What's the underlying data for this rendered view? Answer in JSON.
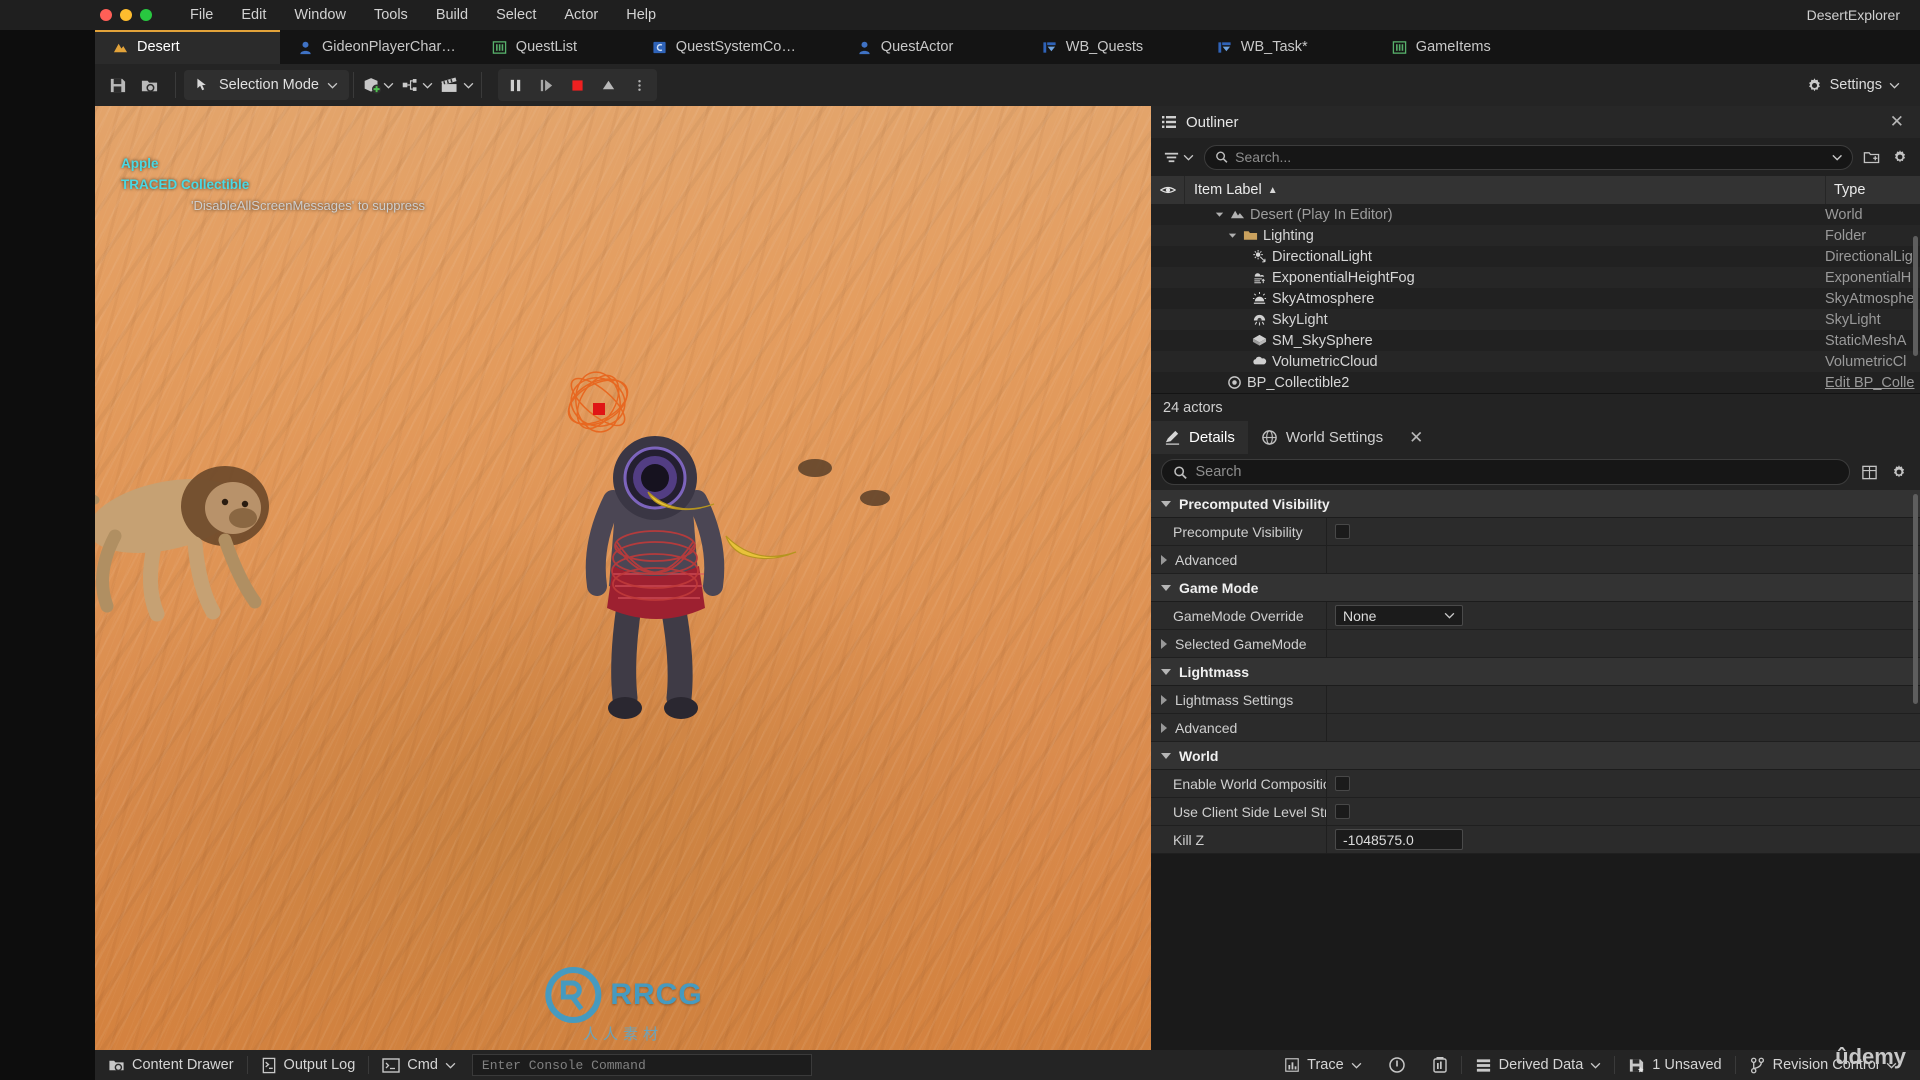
{
  "window": {
    "title": "DesertExplorer"
  },
  "menu": {
    "items": [
      "File",
      "Edit",
      "Window",
      "Tools",
      "Build",
      "Select",
      "Actor",
      "Help"
    ]
  },
  "tabs": [
    {
      "label": "Desert",
      "icon": "level-icon",
      "active": true
    },
    {
      "label": "GideonPlayerChar…",
      "icon": "blueprint-character-icon",
      "active": false
    },
    {
      "label": "QuestList",
      "icon": "datatable-icon",
      "active": false
    },
    {
      "label": "QuestSystemCo…",
      "icon": "blueprint-component-icon",
      "active": false
    },
    {
      "label": "QuestActor",
      "icon": "blueprint-actor-icon",
      "active": false
    },
    {
      "label": "WB_Quests",
      "icon": "widget-blueprint-icon",
      "active": false
    },
    {
      "label": "WB_Task*",
      "icon": "widget-blueprint-icon",
      "active": false
    },
    {
      "label": "GameItems",
      "icon": "datatable-icon",
      "active": false
    }
  ],
  "toolbar": {
    "save_label": "Save",
    "browse_label": "Browse",
    "mode_label": "Selection Mode",
    "add_label": "Add",
    "blueprints_label": "Blueprints",
    "cinematics_label": "Cinematics",
    "pause_label": "Pause",
    "frame_label": "Skip Frame",
    "stop_label": "Stop",
    "eject_label": "Eject",
    "options_label": "More Options",
    "settings_label": "Settings"
  },
  "viewport": {
    "debug_lines": [
      "Apple",
      "TRACED Collectible",
      "'DisableAllScreenMessages' to suppress"
    ],
    "watermark": {
      "text": "RRCG",
      "sub": "人人素材"
    },
    "brand": "ûdemy"
  },
  "outliner": {
    "title": "Outliner",
    "search_placeholder": "Search...",
    "columns": {
      "label": "Item Label",
      "type": "Type"
    },
    "sort_indicator": "▲",
    "rows": [
      {
        "label": "Desert (Play In Editor)",
        "type": "World",
        "indent": 1,
        "arrow": "down",
        "icon": "world-icon",
        "dim": true
      },
      {
        "label": "Lighting",
        "type": "Folder",
        "indent": 2,
        "arrow": "down",
        "icon": "folder-icon",
        "dim": false
      },
      {
        "label": "DirectionalLight",
        "type": "DirectionalLig",
        "indent": 3,
        "arrow": "none",
        "icon": "directional-light-icon",
        "dim": false
      },
      {
        "label": "ExponentialHeightFog",
        "type": "ExponentialH",
        "indent": 3,
        "arrow": "none",
        "icon": "fog-icon",
        "dim": false
      },
      {
        "label": "SkyAtmosphere",
        "type": "SkyAtmosphe",
        "indent": 3,
        "arrow": "none",
        "icon": "sky-atmosphere-icon",
        "dim": false
      },
      {
        "label": "SkyLight",
        "type": "SkyLight",
        "indent": 3,
        "arrow": "none",
        "icon": "sky-light-icon",
        "dim": false
      },
      {
        "label": "SM_SkySphere",
        "type": "StaticMeshA",
        "indent": 3,
        "arrow": "none",
        "icon": "static-mesh-icon",
        "dim": false
      },
      {
        "label": "VolumetricCloud",
        "type": "VolumetricCl",
        "indent": 3,
        "arrow": "none",
        "icon": "cloud-icon",
        "dim": false
      },
      {
        "label": "BP_Collectible2",
        "type": "Edit BP_Colle",
        "indent": 2,
        "arrow": "none",
        "icon": "blueprint-actor-icon",
        "dim": false,
        "type_is_link": true
      }
    ],
    "actor_count": "24 actors"
  },
  "details": {
    "tabs": [
      {
        "label": "Details",
        "icon": "details-icon",
        "active": true
      },
      {
        "label": "World Settings",
        "icon": "world-settings-icon",
        "active": false
      }
    ],
    "search_placeholder": "Search",
    "sections": [
      {
        "name": "Precomputed Visibility",
        "expanded": true,
        "rows": [
          {
            "label": "Precompute Visibility",
            "control": "checkbox",
            "value": "",
            "expandable": false
          },
          {
            "label": "Advanced",
            "control": "none",
            "value": "",
            "expandable": true
          }
        ]
      },
      {
        "name": "Game Mode",
        "expanded": true,
        "rows": [
          {
            "label": "GameMode Override",
            "control": "dropdown",
            "value": "None",
            "expandable": false
          },
          {
            "label": "Selected GameMode",
            "control": "none",
            "value": "",
            "expandable": true
          }
        ]
      },
      {
        "name": "Lightmass",
        "expanded": true,
        "rows": [
          {
            "label": "Lightmass Settings",
            "control": "none",
            "value": "",
            "expandable": true
          },
          {
            "label": "Advanced",
            "control": "none",
            "value": "",
            "expandable": true
          }
        ]
      },
      {
        "name": "World",
        "expanded": true,
        "rows": [
          {
            "label": "Enable World Composition",
            "control": "checkbox",
            "value": "",
            "expandable": false
          },
          {
            "label": "Use Client Side Level Strea…",
            "control": "checkbox",
            "value": "",
            "expandable": false
          },
          {
            "label": "Kill Z",
            "control": "number",
            "value": "-1048575.0",
            "expandable": false
          }
        ]
      }
    ]
  },
  "statusbar": {
    "content_drawer": "Content Drawer",
    "output_log": "Output Log",
    "cmd": "Cmd",
    "console_placeholder": "Enter Console Command",
    "trace": "Trace",
    "derived_data": "Derived Data",
    "unsaved": "1 Unsaved",
    "revision_control": "Revision Control"
  },
  "colors": {
    "accent": "#e3a33a",
    "link": "#4d9de0",
    "stop_red": "#ef2020",
    "debug_cyan": "#4ad9e4",
    "panel_bg": "#2b2b2b",
    "toolbar_bg": "#242424"
  }
}
